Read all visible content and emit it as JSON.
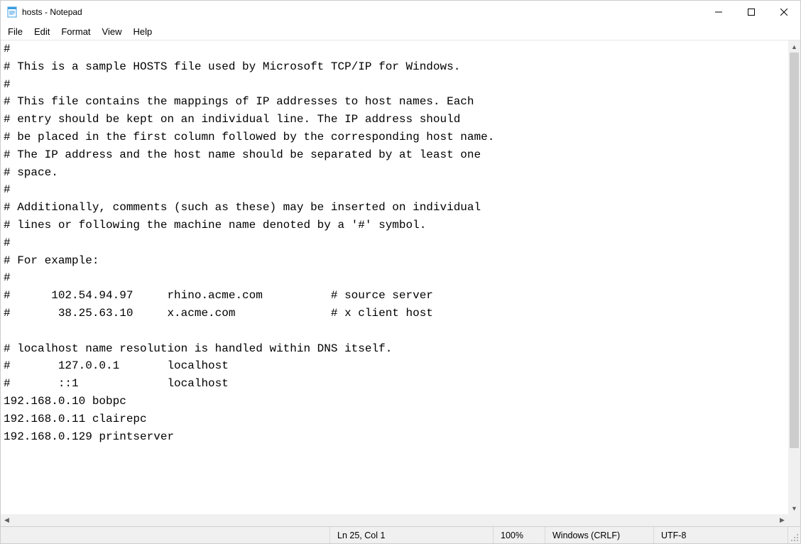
{
  "window": {
    "title": "hosts - Notepad"
  },
  "menu": {
    "file": "File",
    "edit": "Edit",
    "format": "Format",
    "view": "View",
    "help": "Help"
  },
  "editor": {
    "content": "#\n# This is a sample HOSTS file used by Microsoft TCP/IP for Windows.\n#\n# This file contains the mappings of IP addresses to host names. Each\n# entry should be kept on an individual line. The IP address should\n# be placed in the first column followed by the corresponding host name.\n# The IP address and the host name should be separated by at least one\n# space.\n#\n# Additionally, comments (such as these) may be inserted on individual\n# lines or following the machine name denoted by a '#' symbol.\n#\n# For example:\n#\n#      102.54.94.97     rhino.acme.com          # source server\n#       38.25.63.10     x.acme.com              # x client host\n\n# localhost name resolution is handled within DNS itself.\n#       127.0.0.1       localhost\n#       ::1             localhost\n192.168.0.10 bobpc\n192.168.0.11 clairepc\n192.168.0.129 printserver\n"
  },
  "status": {
    "position": "Ln 25, Col 1",
    "zoom": "100%",
    "line_ending": "Windows (CRLF)",
    "encoding": "UTF-8"
  }
}
